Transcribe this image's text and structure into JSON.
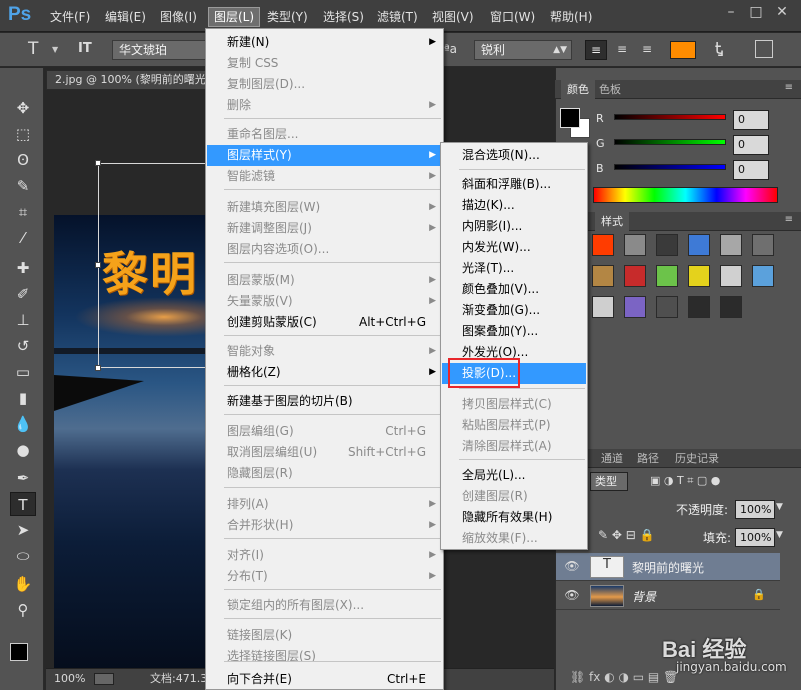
{
  "app": {
    "logo": "Ps",
    "menus": [
      "文件(F)",
      "编辑(E)",
      "图像(I)",
      "图层(L)",
      "类型(Y)",
      "选择(S)",
      "滤镜(T)",
      "视图(V)",
      "窗口(W)",
      "帮助(H)"
    ],
    "active_menu_index": 3,
    "window_controls": [
      "minimize-icon",
      "maximize-icon",
      "close-icon"
    ]
  },
  "options_bar": {
    "tool_icon": "T",
    "orient_icon": "IT",
    "font_family": "华文琥珀",
    "antialias_label": "ªa",
    "antialias": "锐利",
    "text_color": "#ff8c00"
  },
  "document": {
    "tab_title": "2.jpg @ 100% (黎明前的曙光",
    "canvas_text": "黎明",
    "zoom": "100%",
    "doc_info": "文档:471.3"
  },
  "layer_menu": {
    "items": [
      {
        "label": "新建(N)",
        "disabled": false,
        "submenu": true
      },
      {
        "label": "复制 CSS",
        "disabled": true
      },
      {
        "label": "复制图层(D)...",
        "disabled": true
      },
      {
        "label": "删除",
        "disabled": true,
        "submenu": true
      },
      {
        "label": "重命名图层...",
        "disabled": true
      },
      {
        "label": "图层样式(Y)",
        "disabled": false,
        "submenu": true,
        "highlighted": true
      },
      {
        "label": "智能滤镜",
        "disabled": true,
        "submenu": true
      },
      {
        "label": "新建填充图层(W)",
        "disabled": true,
        "submenu": true
      },
      {
        "label": "新建调整图层(J)",
        "disabled": true,
        "submenu": true
      },
      {
        "label": "图层内容选项(O)...",
        "disabled": true
      },
      {
        "label": "图层蒙版(M)",
        "disabled": true,
        "submenu": true
      },
      {
        "label": "矢量蒙版(V)",
        "disabled": true,
        "submenu": true
      },
      {
        "label": "创建剪贴蒙版(C)",
        "disabled": false,
        "shortcut": "Alt+Ctrl+G"
      },
      {
        "label": "智能对象",
        "disabled": true,
        "submenu": true
      },
      {
        "label": "栅格化(Z)",
        "disabled": false,
        "submenu": true
      },
      {
        "label": "新建基于图层的切片(B)",
        "disabled": false
      },
      {
        "label": "图层编组(G)",
        "disabled": true,
        "shortcut": "Ctrl+G"
      },
      {
        "label": "取消图层编组(U)",
        "disabled": true,
        "shortcut": "Shift+Ctrl+G"
      },
      {
        "label": "隐藏图层(R)",
        "disabled": true
      },
      {
        "label": "排列(A)",
        "disabled": true,
        "submenu": true
      },
      {
        "label": "合并形状(H)",
        "disabled": true,
        "submenu": true
      },
      {
        "label": "对齐(I)",
        "disabled": true,
        "submenu": true
      },
      {
        "label": "分布(T)",
        "disabled": true,
        "submenu": true
      },
      {
        "label": "锁定组内的所有图层(X)...",
        "disabled": true
      },
      {
        "label": "链接图层(K)",
        "disabled": true
      },
      {
        "label": "选择链接图层(S)",
        "disabled": true
      },
      {
        "label": "向下合并(E)",
        "disabled": false,
        "shortcut": "Ctrl+E"
      }
    ]
  },
  "style_submenu": {
    "items": [
      {
        "label": "混合选项(N)...",
        "disabled": false
      },
      {
        "label": "斜面和浮雕(B)...",
        "disabled": false
      },
      {
        "label": "描边(K)...",
        "disabled": false
      },
      {
        "label": "内阴影(I)...",
        "disabled": false
      },
      {
        "label": "内发光(W)...",
        "disabled": false
      },
      {
        "label": "光泽(T)...",
        "disabled": false
      },
      {
        "label": "颜色叠加(V)...",
        "disabled": false
      },
      {
        "label": "渐变叠加(G)...",
        "disabled": false
      },
      {
        "label": "图案叠加(Y)...",
        "disabled": false
      },
      {
        "label": "外发光(O)...",
        "disabled": false
      },
      {
        "label": "投影(D)...",
        "disabled": false,
        "highlighted": true
      },
      {
        "label": "拷贝图层样式(C)",
        "disabled": true
      },
      {
        "label": "粘贴图层样式(P)",
        "disabled": true
      },
      {
        "label": "清除图层样式(A)",
        "disabled": true
      },
      {
        "label": "全局光(L)...",
        "disabled": false
      },
      {
        "label": "创建图层(R)",
        "disabled": true
      },
      {
        "label": "隐藏所有效果(H)",
        "disabled": false
      },
      {
        "label": "缩放效果(F)...",
        "disabled": true
      }
    ]
  },
  "color_panel": {
    "tabs": [
      "颜色",
      "色板"
    ],
    "channels": [
      {
        "label": "R",
        "value": "0",
        "color": "#ff0000"
      },
      {
        "label": "G",
        "value": "0",
        "color": "#00ff00"
      },
      {
        "label": "B",
        "value": "0",
        "color": "#0000ff"
      }
    ]
  },
  "styles_panel": {
    "tab": "样式",
    "swatch_colors": [
      "#ff3c00",
      "#8a8a8a",
      "#3a3a3a",
      "#3e7ad6",
      "#a7a7a7",
      "#6f6f6f",
      "#b38644",
      "#c72b2b",
      "#6cc34a",
      "#e4d21c",
      "#d0d0d0",
      "#5ba1dc",
      "#cfcfcf",
      "#7b64c4",
      "#4f4f4f",
      "#2b2b2b",
      "#2b2b2b"
    ]
  },
  "layers_panel": {
    "tabs": [
      "通道",
      "路径",
      "历史记录"
    ],
    "kind_label": "类型",
    "opacity_label": "不透明度:",
    "opacity": "100%",
    "fill_label": "填充:",
    "fill": "100%",
    "layers": [
      {
        "name": "黎明前的曙光",
        "type": "text",
        "selected": true
      },
      {
        "name": "背景",
        "type": "image",
        "locked": true
      }
    ]
  },
  "watermark": {
    "text": "Bai 经验",
    "url": "jingyan.baidu.com"
  }
}
